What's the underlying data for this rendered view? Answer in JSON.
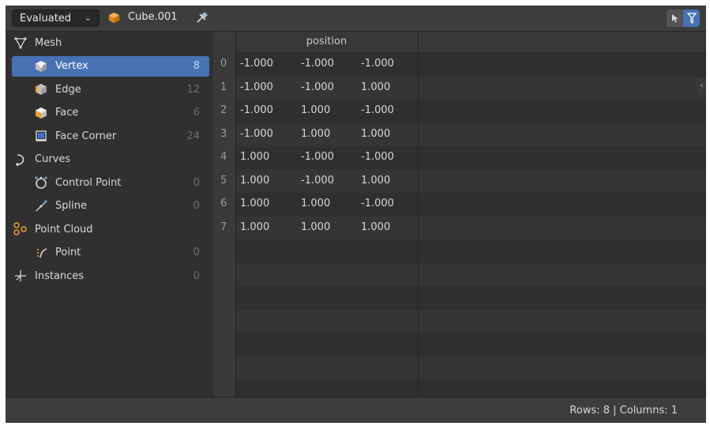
{
  "header": {
    "mode": "Evaluated",
    "object_name": "Cube.001",
    "icons": {
      "object": "cube-object-icon",
      "pin": "pin-icon",
      "select": "cursor-icon",
      "filter": "funnel-filter-icon"
    }
  },
  "sidebar": {
    "items": [
      {
        "label": "Mesh",
        "count": "",
        "icon": "mesh-icon",
        "level": 0,
        "selected": false
      },
      {
        "label": "Vertex",
        "count": "8",
        "icon": "vertex-icon",
        "level": 1,
        "selected": true
      },
      {
        "label": "Edge",
        "count": "12",
        "icon": "edge-icon",
        "level": 1,
        "selected": false
      },
      {
        "label": "Face",
        "count": "6",
        "icon": "face-icon",
        "level": 1,
        "selected": false
      },
      {
        "label": "Face Corner",
        "count": "24",
        "icon": "face-corner-icon",
        "level": 1,
        "selected": false
      },
      {
        "label": "Curves",
        "count": "",
        "icon": "curves-icon",
        "level": 0,
        "selected": false
      },
      {
        "label": "Control Point",
        "count": "0",
        "icon": "control-point-icon",
        "level": 1,
        "selected": false
      },
      {
        "label": "Spline",
        "count": "0",
        "icon": "spline-icon",
        "level": 1,
        "selected": false
      },
      {
        "label": "Point Cloud",
        "count": "",
        "icon": "point-cloud-icon",
        "level": 0,
        "selected": false
      },
      {
        "label": "Point",
        "count": "0",
        "icon": "point-icon",
        "level": 1,
        "selected": false
      },
      {
        "label": "Instances",
        "count": "0",
        "icon": "instances-icon",
        "level": 0,
        "selected": false
      }
    ]
  },
  "table": {
    "column_header": "position",
    "rows": [
      {
        "index": "0",
        "values": [
          "-1.000",
          "-1.000",
          "-1.000"
        ]
      },
      {
        "index": "1",
        "values": [
          "-1.000",
          "-1.000",
          "1.000"
        ]
      },
      {
        "index": "2",
        "values": [
          "-1.000",
          "1.000",
          "-1.000"
        ]
      },
      {
        "index": "3",
        "values": [
          "-1.000",
          "1.000",
          "1.000"
        ]
      },
      {
        "index": "4",
        "values": [
          "1.000",
          "-1.000",
          "-1.000"
        ]
      },
      {
        "index": "5",
        "values": [
          "1.000",
          "-1.000",
          "1.000"
        ]
      },
      {
        "index": "6",
        "values": [
          "1.000",
          "1.000",
          "-1.000"
        ]
      },
      {
        "index": "7",
        "values": [
          "1.000",
          "1.000",
          "1.000"
        ]
      }
    ]
  },
  "footer": {
    "status": "Rows: 8   |   Columns: 1"
  },
  "colors": {
    "accent": "#4772b3",
    "background": "#303030",
    "header": "#3d3d3d",
    "orange": "#f0a030"
  }
}
